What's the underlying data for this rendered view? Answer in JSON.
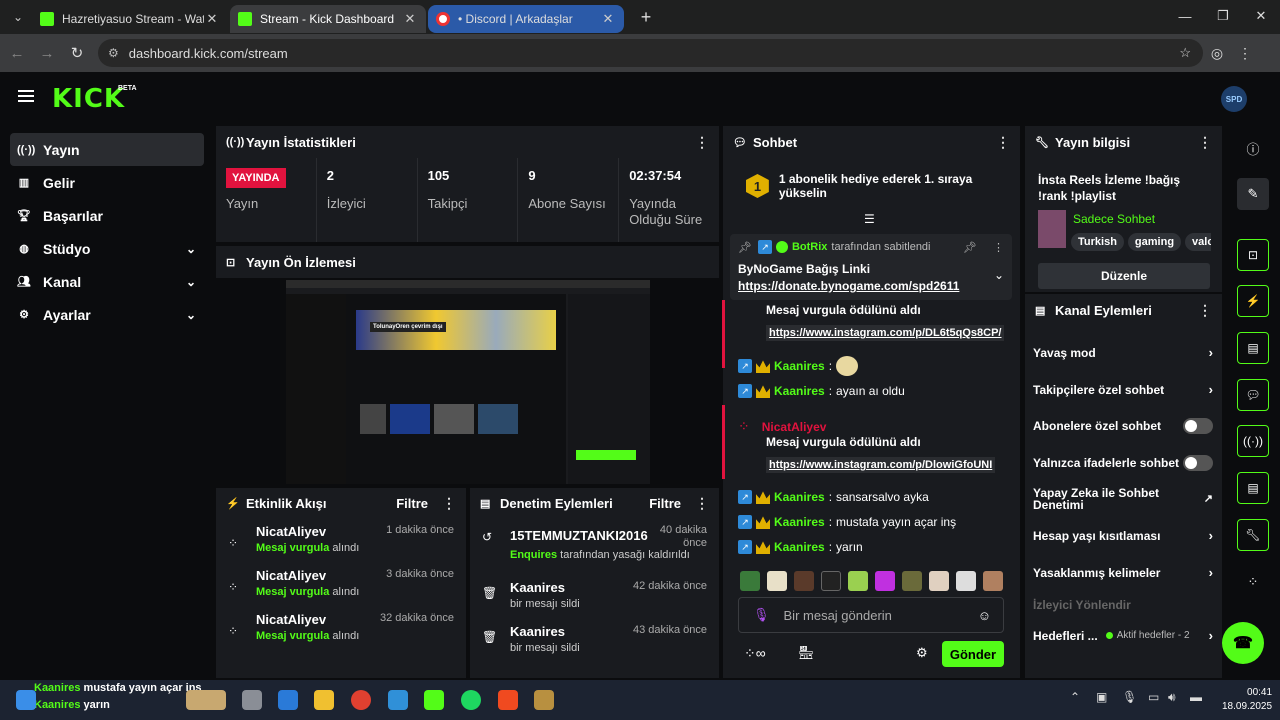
{
  "browser": {
    "tabs": [
      {
        "title": "Hazretiyasuo Stream - Watch Li",
        "active": false
      },
      {
        "title": "Stream - Kick Dashboard",
        "active": true
      },
      {
        "title": "• Discord | Arkadaşlar",
        "active": false
      }
    ],
    "url": "dashboard.kick.com/stream",
    "new_tab": "+",
    "close": "✕"
  },
  "app": {
    "logo": "KICK",
    "beta": "BETA",
    "avatar": "SPD",
    "accent": "#53fc18"
  },
  "sidebar": {
    "items": [
      {
        "label": "Yayın",
        "icon": "broadcast-icon"
      },
      {
        "label": "Gelir",
        "icon": "revenue-icon"
      },
      {
        "label": "Başarılar",
        "icon": "trophy-icon"
      },
      {
        "label": "Stüdyo",
        "icon": "studio-icon"
      },
      {
        "label": "Kanal",
        "icon": "channel-icon"
      },
      {
        "label": "Ayarlar",
        "icon": "gear-icon"
      }
    ]
  },
  "stats_panel": {
    "title": "Yayın İstatistikleri",
    "live_badge": "YAYINDA",
    "live_label": "Yayın",
    "stats": [
      {
        "value": "2",
        "label": "İzleyici"
      },
      {
        "value": "105",
        "label": "Takipçi"
      },
      {
        "value": "9",
        "label": "Abone Sayısı"
      },
      {
        "value": "02:37:54",
        "label": "Yayında Olduğu Süre"
      }
    ]
  },
  "preview_panel": {
    "title": "Yayın Ön İzlemesi",
    "thumb_text": "TolunayOren çevrim dışı"
  },
  "activity": {
    "title": "Etkinlik Akışı",
    "filter": "Filtre",
    "items": [
      {
        "name": "NicatAliyev",
        "highlight": "Mesaj vurgula",
        "suffix": "alındı",
        "time": "1 dakika önce"
      },
      {
        "name": "NicatAliyev",
        "highlight": "Mesaj vurgula",
        "suffix": "alındı",
        "time": "3 dakika önce"
      },
      {
        "name": "NicatAliyev",
        "highlight": "Mesaj vurgula",
        "suffix": "alındı",
        "time": "32 dakika önce"
      }
    ]
  },
  "moderation": {
    "title": "Denetim Eylemleri",
    "filter": "Filtre",
    "items": [
      {
        "name": "15TEMMUZTANKI2016",
        "by": "Enquires",
        "text": "tarafından yasağı kaldırıldı",
        "time": "40 dakika önce"
      },
      {
        "name": "Kaanires",
        "text": "bir mesajı sildi",
        "time": "42 dakika önce"
      },
      {
        "name": "Kaanires",
        "text": "bir mesajı sildi",
        "time": "43 dakika önce"
      }
    ]
  },
  "chat": {
    "title": "Sohbet",
    "gift_rank": "1",
    "gift_text": "1 abonelik hediye ederek 1. sıraya yükselin",
    "pinned_by": "BotRix",
    "pinned_suffix": "tarafından sabitlendi",
    "pinned_title": "ByNoGame Bağış Linki",
    "pinned_link": "https://donate.bynogame.com/spd2611",
    "messages": [
      {
        "user": "",
        "title": "Mesaj vurgula ödülünü aldı",
        "link": "https://www.instagram.com/p/DL6t5qQs8CP/"
      },
      {
        "user": "Kaanires",
        "text": ""
      },
      {
        "user": "Kaanires",
        "text": "ayaın aı oldu"
      },
      {
        "user": "NicatAliyev",
        "title": "Mesaj vurgula ödülünü aldı",
        "link": "https://www.instagram.com/p/DlowiGfoUNI"
      },
      {
        "user": "Kaanires",
        "text": "sansarsalvo ayka"
      },
      {
        "user": "Kaanires",
        "text": "mustafa yayın açar inş"
      },
      {
        "user": "Kaanires",
        "text": "yarın"
      }
    ],
    "placeholder": "Bir mesaj gönderin",
    "send": "Gönder"
  },
  "stream_info": {
    "title": "Yayın bilgisi",
    "stream_title": "İnsta Reels İzleme !bağış !rank !playlist",
    "category": "Sadece Sohbet",
    "tags": [
      "Turkish",
      "gaming",
      "valo"
    ],
    "edit": "Düzenle"
  },
  "channel_actions": {
    "title": "Kanal Eylemleri",
    "items": [
      {
        "label": "Yavaş mod",
        "control": "arrow"
      },
      {
        "label": "Takipçilere özel sohbet",
        "control": "arrow"
      },
      {
        "label": "Abonelere özel sohbet",
        "control": "toggle"
      },
      {
        "label": "Yalnızca ifadelerle sohbet",
        "control": "toggle"
      },
      {
        "label": "Yapay Zeka ile Sohbet Denetimi",
        "control": "external"
      },
      {
        "label": "Hesap yaşı kısıtlaması",
        "control": "arrow"
      },
      {
        "label": "Yasaklanmış kelimeler",
        "control": "arrow"
      }
    ],
    "section": "İzleyici Yönlendir",
    "goals_label": "Hedefleri ...",
    "goals_status": "Aktif hedefler - 2"
  },
  "taskbar": {
    "overlay_user1": "Kaanires",
    "overlay_text1": "mustafa yayın açar inş",
    "overlay_user2": "Kaanires",
    "overlay_text2": "yarın",
    "time": "00:41",
    "date": "18.09.2025"
  }
}
